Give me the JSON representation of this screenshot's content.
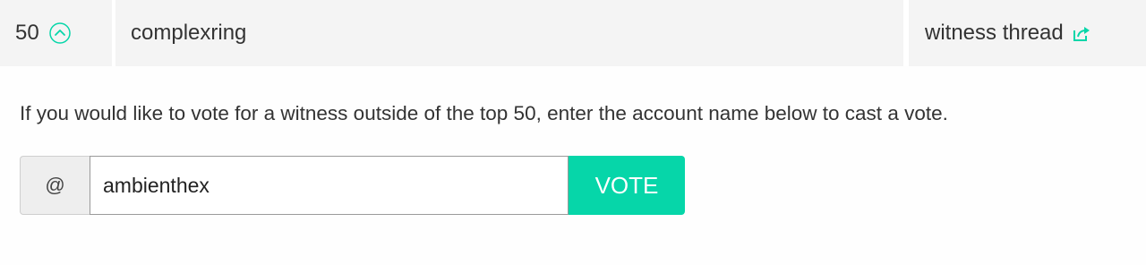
{
  "witness_row": {
    "rank": "50",
    "name": "complexring",
    "thread_label": "witness thread",
    "upvote_icon": "chevron-up-circle-icon",
    "external_icon": "external-link-icon"
  },
  "info": {
    "text": "If you would like to vote for a witness outside of the top 50, enter the account name below to cast a vote."
  },
  "vote_form": {
    "prefix": "@",
    "account_value": "ambienthex",
    "button_label": "VOTE"
  },
  "colors": {
    "accent": "#06d6a9",
    "cell_bg": "#f4f4f4",
    "text": "#333333"
  }
}
